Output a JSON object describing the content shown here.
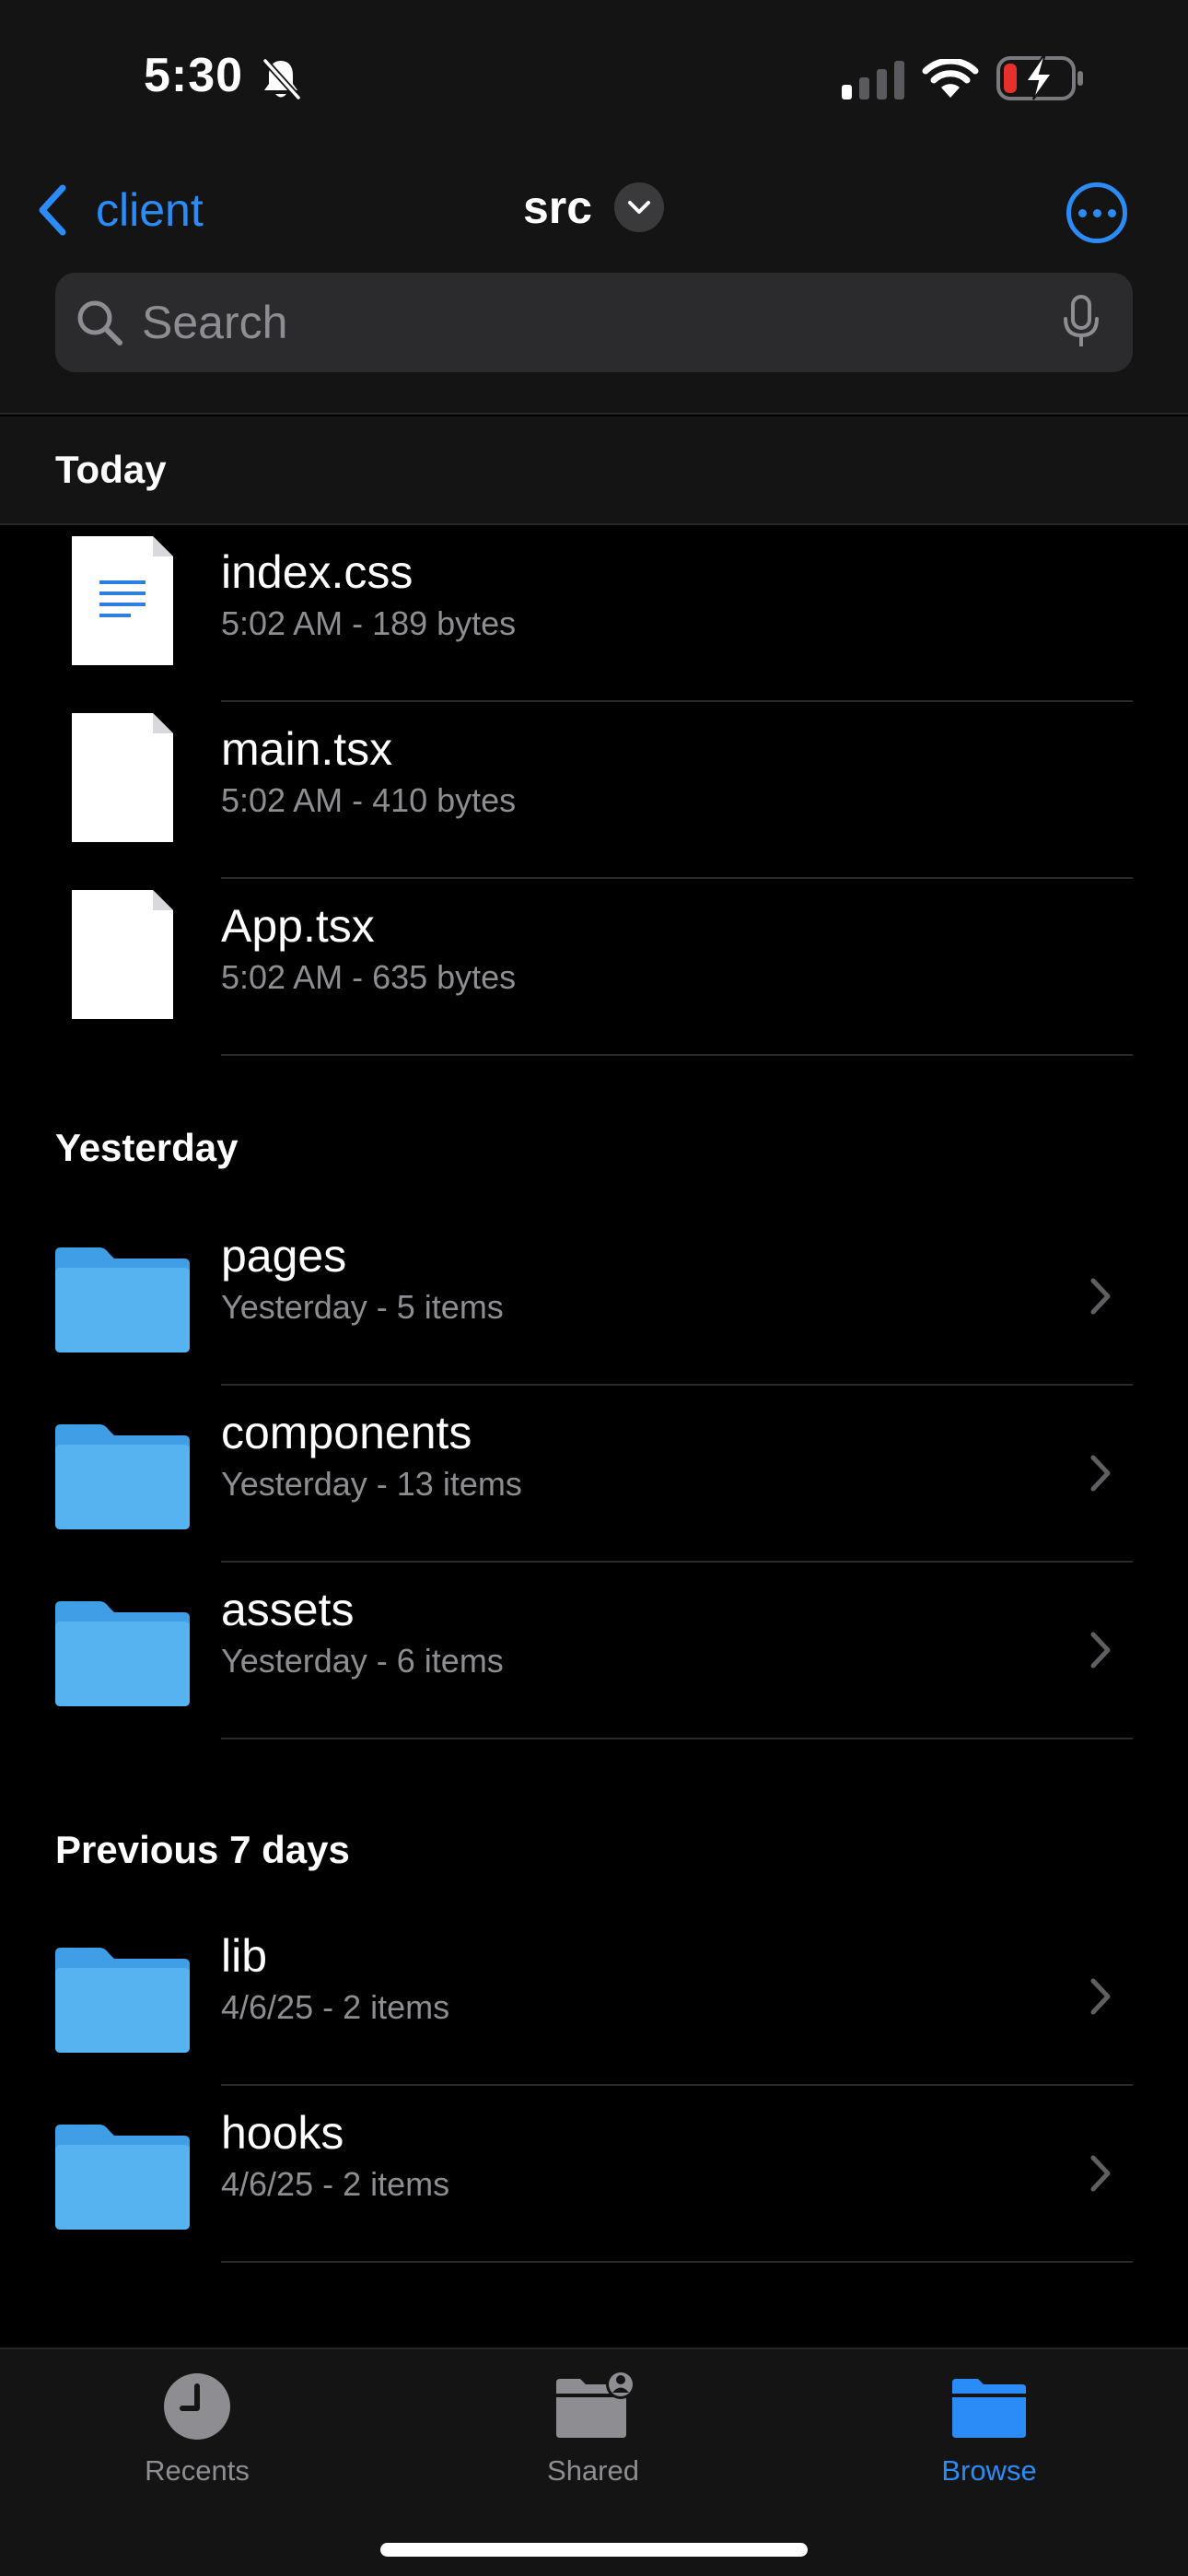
{
  "status": {
    "time": "5:30"
  },
  "nav": {
    "back_label": "client",
    "title": "src"
  },
  "search": {
    "placeholder": "Search"
  },
  "colors": {
    "accent": "#2b8cf7",
    "folder": "#4aa8ea",
    "background": "#000000",
    "battery_low": "#e5302d"
  },
  "sections": [
    {
      "title": "Today",
      "items": [
        {
          "name": "index.css",
          "meta": "5:02 AM - 189 bytes",
          "kind": "text-document-icon"
        },
        {
          "name": "main.tsx",
          "meta": "5:02 AM - 410 bytes",
          "kind": "blank-document-icon"
        },
        {
          "name": "App.tsx",
          "meta": "5:02 AM - 635 bytes",
          "kind": "blank-document-icon"
        }
      ]
    },
    {
      "title": "Yesterday",
      "items": [
        {
          "name": "pages",
          "meta": "Yesterday - 5 items",
          "kind": "folder-icon"
        },
        {
          "name": "components",
          "meta": "Yesterday - 13 items",
          "kind": "folder-icon"
        },
        {
          "name": "assets",
          "meta": "Yesterday - 6 items",
          "kind": "folder-icon"
        }
      ]
    },
    {
      "title": "Previous 7 days",
      "items": [
        {
          "name": "lib",
          "meta": "4/6/25 - 2 items",
          "kind": "folder-icon"
        },
        {
          "name": "hooks",
          "meta": "4/6/25 - 2 items",
          "kind": "folder-icon"
        }
      ]
    }
  ],
  "tabs": [
    {
      "label": "Recents",
      "icon": "clock-icon",
      "active": false
    },
    {
      "label": "Shared",
      "icon": "shared-folder-icon",
      "active": false
    },
    {
      "label": "Browse",
      "icon": "folder-icon",
      "active": true
    }
  ]
}
